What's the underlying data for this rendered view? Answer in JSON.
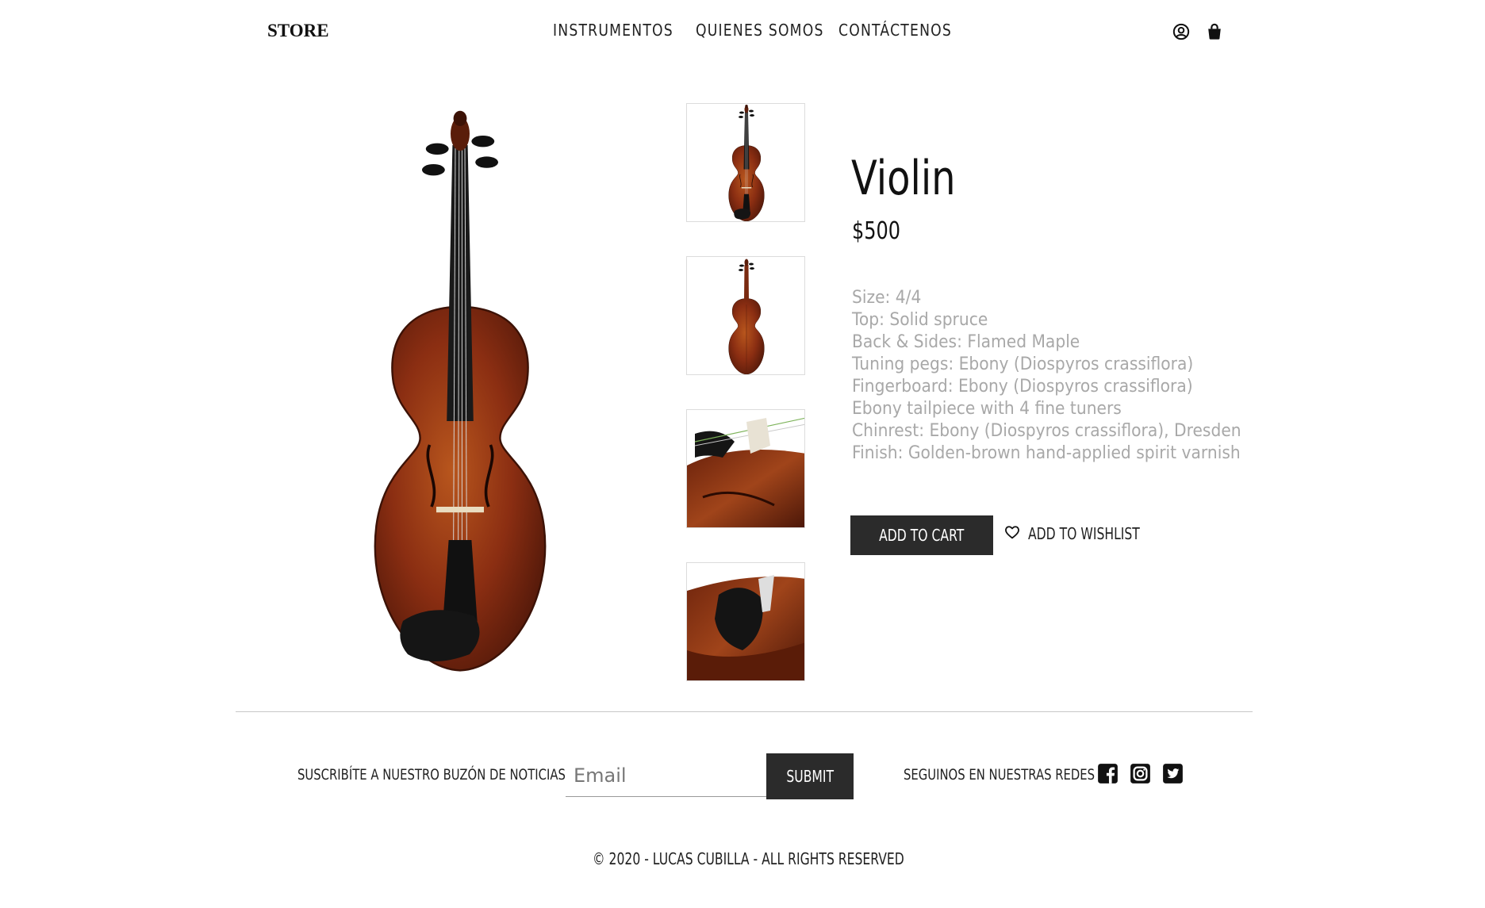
{
  "header": {
    "logo": "STORE",
    "nav": [
      "INSTRUMENTOS",
      "QUIENES SOMOS",
      "CONTÁCTENOS"
    ],
    "icons": [
      "user-circle-icon",
      "shopping-bag-icon"
    ]
  },
  "product": {
    "name": "Violin",
    "price": "$500",
    "specs": [
      "Size: 4/4",
      "Top: Solid spruce",
      "Back & Sides: Flamed Maple",
      "Tuning pegs: Ebony (Diospyros crassiflora)",
      "Fingerboard: Ebony (Diospyros crassiflora)",
      "Ebony tailpiece with 4 fine tuners",
      "Chinrest: Ebony (Diospyros crassiflora), Dresden",
      "Finish: Golden-brown hand-applied spirit varnish"
    ],
    "add_to_cart": "ADD TO CART",
    "add_to_wishlist": "ADD TO WISHLIST",
    "thumbnails": [
      "violin-front",
      "violin-back",
      "violin-scroll-detail",
      "violin-chinrest-detail"
    ]
  },
  "footer": {
    "subscribe_label": "SUSCRIBÍTE A NUESTRO BUZÓN DE NOTICIAS",
    "email_placeholder": "Email",
    "submit_label": "SUBMIT",
    "social_label": "SEGUINOS EN NUESTRAS REDES",
    "social_icons": [
      "facebook-icon",
      "instagram-icon",
      "twitter-icon"
    ],
    "copyright": "© 2020 - LUCAS CUBILLA - ALL RIGHTS RESERVED"
  },
  "colors": {
    "text": "#222222",
    "muted_text": "#a8a8a8",
    "button_bg": "#2b2b2b",
    "wood": "#8b2e12"
  }
}
